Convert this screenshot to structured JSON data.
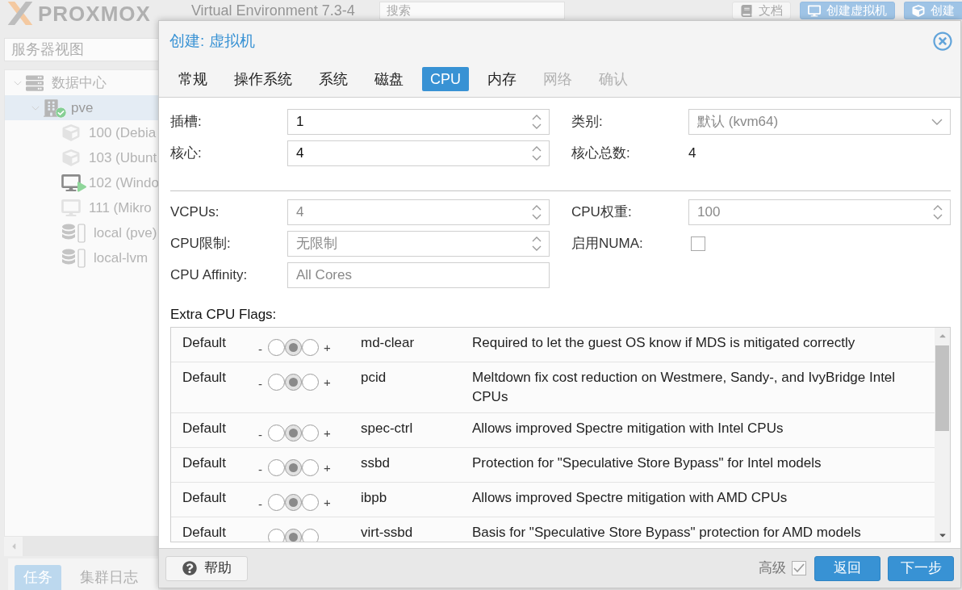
{
  "header": {
    "logo": "PROXMOX",
    "product": "Virtual Environment 7.3-4",
    "search": {
      "placeholder": "搜索"
    },
    "buttons": [
      {
        "label": "文档",
        "kind": "docs"
      },
      {
        "label": "创建虚拟机",
        "kind": "vm"
      },
      {
        "label": "创建",
        "kind": "container"
      }
    ]
  },
  "sidebar": {
    "view": "服务器视图",
    "tree": [
      {
        "label": "数据中心",
        "kind": "datacenter",
        "selected": false,
        "expanded": true,
        "children": [
          {
            "label": "pve",
            "kind": "node",
            "selected": true,
            "expanded": true,
            "online": true,
            "children": [
              {
                "label": "100 (Debia",
                "kind": "container",
                "selected": false,
                "running": false
              },
              {
                "label": "103 (Ubunt",
                "kind": "container",
                "selected": false,
                "running": false
              },
              {
                "label": "102 (Windo",
                "kind": "vm",
                "selected": false,
                "running": true
              },
              {
                "label": "111 (Mikro",
                "kind": "vm",
                "selected": false,
                "running": false
              },
              {
                "label": "local (pve)",
                "kind": "storage",
                "selected": false
              },
              {
                "label": "local-lvm",
                "kind": "storage",
                "selected": false
              }
            ]
          }
        ]
      }
    ],
    "tabs": [
      {
        "label": "任务",
        "selected": true
      },
      {
        "label": "集群日志",
        "selected": false
      }
    ]
  },
  "dialog": {
    "title": "创建: 虚拟机",
    "tabs": [
      {
        "label": "常规",
        "selected": false,
        "disabled": false
      },
      {
        "label": "操作系统",
        "selected": false,
        "disabled": false
      },
      {
        "label": "系统",
        "selected": false,
        "disabled": false
      },
      {
        "label": "磁盘",
        "selected": false,
        "disabled": false
      },
      {
        "label": "CPU",
        "selected": true,
        "disabled": false
      },
      {
        "label": "内存",
        "selected": false,
        "disabled": false
      },
      {
        "label": "网络",
        "selected": false,
        "disabled": true
      },
      {
        "label": "确认",
        "selected": false,
        "disabled": true
      }
    ],
    "sections": [
      {
        "left": [
          {
            "label": "插槽:",
            "kind": "spinner",
            "value": "1"
          },
          {
            "label": "核心:",
            "kind": "spinner",
            "value": "4"
          }
        ],
        "right": [
          {
            "label": "类别:",
            "kind": "combo",
            "placeholder": "默认 (kvm64)"
          },
          {
            "label": "核心总数:",
            "kind": "display",
            "value": "4"
          }
        ]
      },
      {
        "left": [
          {
            "label": "VCPUs:",
            "kind": "spinner",
            "placeholder": "4"
          },
          {
            "label": "CPU限制:",
            "kind": "spinner",
            "placeholder": "无限制"
          },
          {
            "label": "CPU Affinity:",
            "kind": "text",
            "placeholder": "All Cores"
          }
        ],
        "right": [
          {
            "label": "CPU权重:",
            "kind": "spinner",
            "placeholder": "100"
          },
          {
            "label": "启用NUMA:",
            "kind": "checkbox",
            "checked": false
          }
        ]
      }
    ],
    "flags": {
      "title": "Extra CPU Flags:",
      "rows": [
        {
          "setting": "Default",
          "minus": "-",
          "radios": [
            {
              "selected": false
            },
            {
              "selected": true
            },
            {
              "selected": false
            }
          ],
          "plus": "+",
          "flag": "md-clear",
          "description": "Required to let the guest OS know if MDS is mitigated correctly"
        },
        {
          "setting": "Default",
          "minus": "-",
          "radios": [
            {
              "selected": false
            },
            {
              "selected": true
            },
            {
              "selected": false
            }
          ],
          "plus": "+",
          "flag": "pcid",
          "description": "Meltdown fix cost reduction on Westmere, Sandy-, and IvyBridge Intel CPUs"
        },
        {
          "setting": "Default",
          "minus": "-",
          "radios": [
            {
              "selected": false
            },
            {
              "selected": true
            },
            {
              "selected": false
            }
          ],
          "plus": "+",
          "flag": "spec-ctrl",
          "description": "Allows improved Spectre mitigation with Intel CPUs"
        },
        {
          "setting": "Default",
          "minus": "-",
          "radios": [
            {
              "selected": false
            },
            {
              "selected": true
            },
            {
              "selected": false
            }
          ],
          "plus": "+",
          "flag": "ssbd",
          "description": "Protection for \"Speculative Store Bypass\" for Intel models"
        },
        {
          "setting": "Default",
          "minus": "-",
          "radios": [
            {
              "selected": false
            },
            {
              "selected": true
            },
            {
              "selected": false
            }
          ],
          "plus": "+",
          "flag": "ibpb",
          "description": "Allows improved Spectre mitigation with AMD CPUs"
        },
        {
          "setting": "Default",
          "radios": [
            {
              "selected": false
            },
            {
              "selected": true
            },
            {
              "selected": false
            }
          ],
          "flag": "virt-ssbd",
          "description": "Basis for \"Speculative Store Bypass\" protection for AMD models"
        }
      ]
    },
    "help": "帮助",
    "advanced": {
      "label": "高级",
      "checked": true
    },
    "buttons": [
      {
        "label": "返回"
      },
      {
        "label": "下一步"
      }
    ]
  }
}
